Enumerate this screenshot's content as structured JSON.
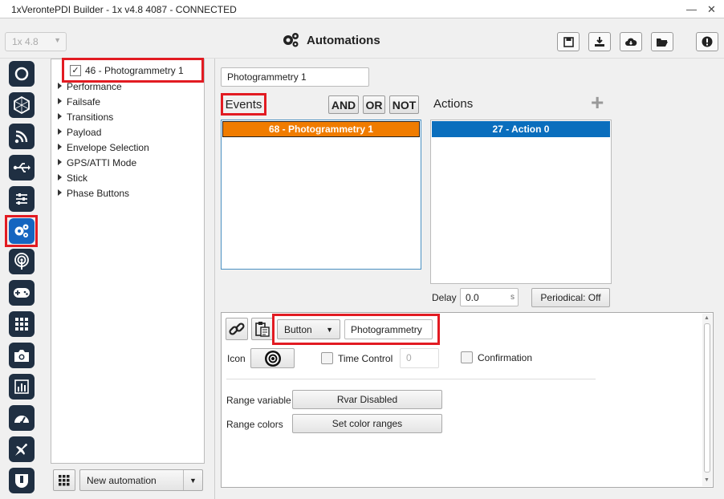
{
  "window": {
    "title": "1xVerontePDI Builder - 1x v4.8 4087 - CONNECTED"
  },
  "header": {
    "version": "1x 4.8",
    "title": "Automations"
  },
  "toolbar_icons": [
    "save-icon",
    "download-icon",
    "cloud-download-icon",
    "folder-open-icon",
    "info-icon"
  ],
  "sidebar_icons": [
    "power-icon",
    "hexagon-icon",
    "rss-icon",
    "usb-icon",
    "sliders-icon",
    "gears-icon",
    "broadcast-icon",
    "gamepad-icon",
    "grid-icon",
    "camera-icon",
    "chart-icon",
    "gauge-icon",
    "plane-icon",
    "shield-icon"
  ],
  "tree": {
    "selected": "46 - Photogrammetry 1",
    "items": [
      "Performance",
      "Failsafe",
      "Transitions",
      "Payload",
      "Envelope Selection",
      "GPS/ATTI Mode",
      "Stick",
      "Phase Buttons"
    ]
  },
  "bottom_bar": {
    "new_automation": "New automation"
  },
  "automation": {
    "name": "Photogrammetry 1"
  },
  "events": {
    "label": "Events",
    "items": [
      "68 - Photogrammetry 1"
    ],
    "and": "AND",
    "or": "OR",
    "not": "NOT"
  },
  "actions": {
    "label": "Actions",
    "items": [
      "27 - Action 0"
    ]
  },
  "delay": {
    "label": "Delay",
    "value": "0.0",
    "unit": "s"
  },
  "periodical": "Periodical: Off",
  "config": {
    "type": "Button",
    "name": "Photogrammetry",
    "icon_label": "Icon",
    "time_control_label": "Time Control",
    "time_control_value": "0",
    "confirmation_label": "Confirmation",
    "range_variable_label": "Range variable",
    "range_variable_btn": "Rvar Disabled",
    "range_colors_label": "Range colors",
    "range_colors_btn": "Set color ranges"
  },
  "colors": {
    "accent_orange": "#f07c00",
    "accent_blue": "#0a6ebd",
    "highlight_red": "#e21b22",
    "sidebar_dark": "#1f2f42"
  }
}
